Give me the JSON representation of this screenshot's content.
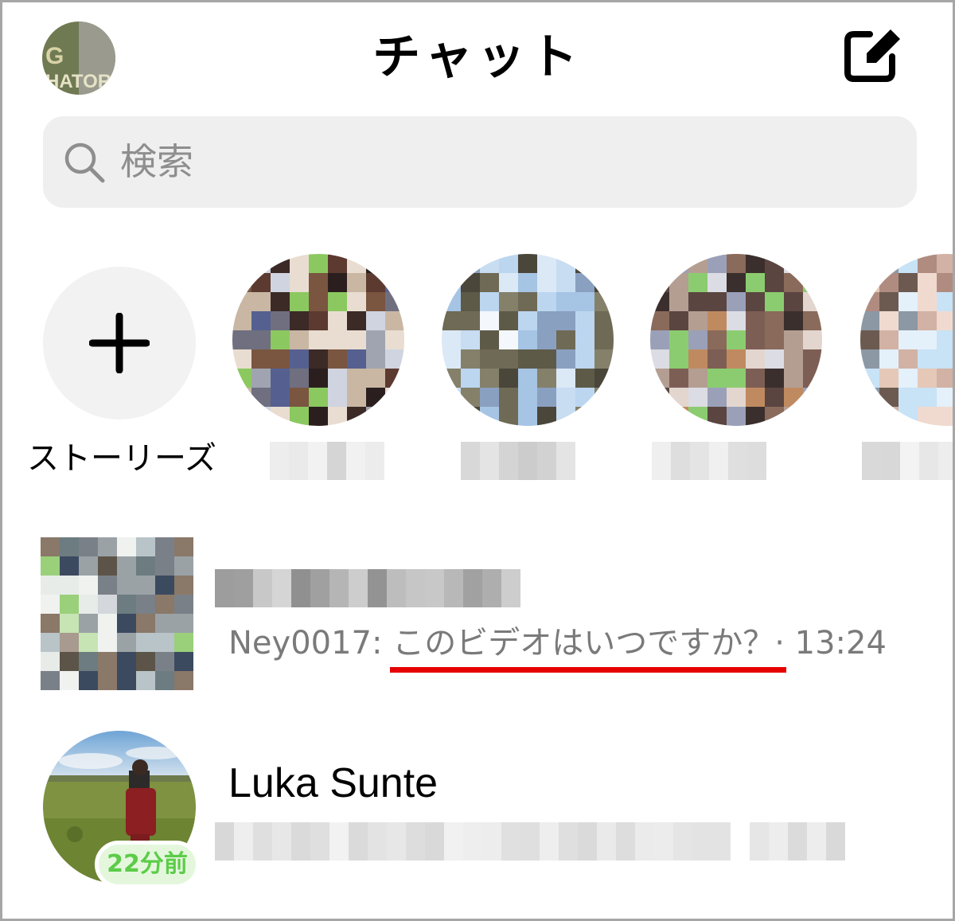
{
  "header": {
    "title": "チャット",
    "profile_avatar_text_line1": "G",
    "profile_avatar_text_line2": "HATOR"
  },
  "search": {
    "placeholder": "検索"
  },
  "stories": {
    "add_label": "ストーリーズ",
    "items": [
      {
        "name": "",
        "image": "pixelated"
      },
      {
        "name": "",
        "image": "pixelated"
      },
      {
        "name": "",
        "image": "pixelated"
      },
      {
        "name": "",
        "image": "pixelated"
      }
    ]
  },
  "chats": [
    {
      "name": "",
      "sender": "Ney0017:",
      "message": "このビデオはいつですか？",
      "separator": "·",
      "time": "13:24"
    },
    {
      "name": "Luka Sunte",
      "message": "",
      "active_badge": "22分前"
    }
  ],
  "colors": {
    "search_bg": "#efefef",
    "highlight_underline": "#e60000",
    "active_badge_text": "#5ccc49",
    "active_badge_bg": "#e4f7dd"
  },
  "icons": {
    "compose": "compose-icon",
    "search": "search-icon",
    "add_story": "plus-icon"
  }
}
